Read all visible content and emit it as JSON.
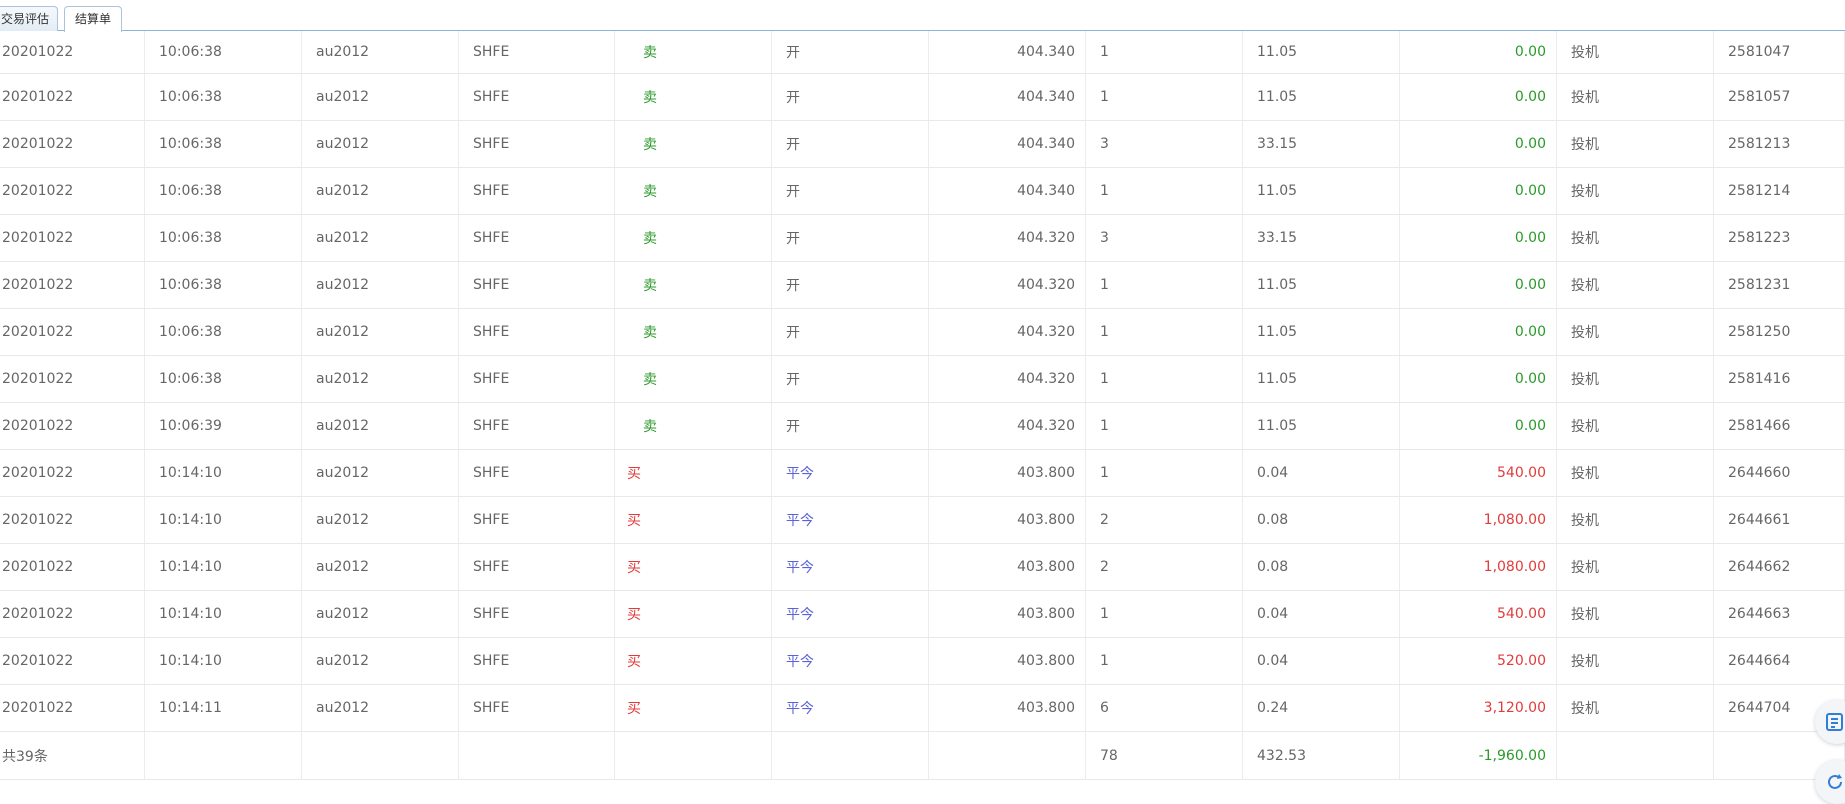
{
  "tabs": [
    {
      "label": "交易评估"
    },
    {
      "label": "结算单"
    }
  ],
  "rows": [
    {
      "date": "20201022",
      "time": "10:06:38",
      "contract": "au2012",
      "exchange": "SHFE",
      "direction": "卖",
      "offset": "开",
      "price": "404.340",
      "volume": "1",
      "fee": "11.05",
      "pnl": "0.00",
      "hedge": "投机",
      "trade_id": "2581047"
    },
    {
      "date": "20201022",
      "time": "10:06:38",
      "contract": "au2012",
      "exchange": "SHFE",
      "direction": "卖",
      "offset": "开",
      "price": "404.340",
      "volume": "1",
      "fee": "11.05",
      "pnl": "0.00",
      "hedge": "投机",
      "trade_id": "2581057"
    },
    {
      "date": "20201022",
      "time": "10:06:38",
      "contract": "au2012",
      "exchange": "SHFE",
      "direction": "卖",
      "offset": "开",
      "price": "404.340",
      "volume": "3",
      "fee": "33.15",
      "pnl": "0.00",
      "hedge": "投机",
      "trade_id": "2581213"
    },
    {
      "date": "20201022",
      "time": "10:06:38",
      "contract": "au2012",
      "exchange": "SHFE",
      "direction": "卖",
      "offset": "开",
      "price": "404.340",
      "volume": "1",
      "fee": "11.05",
      "pnl": "0.00",
      "hedge": "投机",
      "trade_id": "2581214"
    },
    {
      "date": "20201022",
      "time": "10:06:38",
      "contract": "au2012",
      "exchange": "SHFE",
      "direction": "卖",
      "offset": "开",
      "price": "404.320",
      "volume": "3",
      "fee": "33.15",
      "pnl": "0.00",
      "hedge": "投机",
      "trade_id": "2581223"
    },
    {
      "date": "20201022",
      "time": "10:06:38",
      "contract": "au2012",
      "exchange": "SHFE",
      "direction": "卖",
      "offset": "开",
      "price": "404.320",
      "volume": "1",
      "fee": "11.05",
      "pnl": "0.00",
      "hedge": "投机",
      "trade_id": "2581231"
    },
    {
      "date": "20201022",
      "time": "10:06:38",
      "contract": "au2012",
      "exchange": "SHFE",
      "direction": "卖",
      "offset": "开",
      "price": "404.320",
      "volume": "1",
      "fee": "11.05",
      "pnl": "0.00",
      "hedge": "投机",
      "trade_id": "2581250"
    },
    {
      "date": "20201022",
      "time": "10:06:38",
      "contract": "au2012",
      "exchange": "SHFE",
      "direction": "卖",
      "offset": "开",
      "price": "404.320",
      "volume": "1",
      "fee": "11.05",
      "pnl": "0.00",
      "hedge": "投机",
      "trade_id": "2581416"
    },
    {
      "date": "20201022",
      "time": "10:06:39",
      "contract": "au2012",
      "exchange": "SHFE",
      "direction": "卖",
      "offset": "开",
      "price": "404.320",
      "volume": "1",
      "fee": "11.05",
      "pnl": "0.00",
      "hedge": "投机",
      "trade_id": "2581466"
    },
    {
      "date": "20201022",
      "time": "10:14:10",
      "contract": "au2012",
      "exchange": "SHFE",
      "direction": "买",
      "offset": "平今",
      "price": "403.800",
      "volume": "1",
      "fee": "0.04",
      "pnl": "540.00",
      "hedge": "投机",
      "trade_id": "2644660"
    },
    {
      "date": "20201022",
      "time": "10:14:10",
      "contract": "au2012",
      "exchange": "SHFE",
      "direction": "买",
      "offset": "平今",
      "price": "403.800",
      "volume": "2",
      "fee": "0.08",
      "pnl": "1,080.00",
      "hedge": "投机",
      "trade_id": "2644661"
    },
    {
      "date": "20201022",
      "time": "10:14:10",
      "contract": "au2012",
      "exchange": "SHFE",
      "direction": "买",
      "offset": "平今",
      "price": "403.800",
      "volume": "2",
      "fee": "0.08",
      "pnl": "1,080.00",
      "hedge": "投机",
      "trade_id": "2644662"
    },
    {
      "date": "20201022",
      "time": "10:14:10",
      "contract": "au2012",
      "exchange": "SHFE",
      "direction": "买",
      "offset": "平今",
      "price": "403.800",
      "volume": "1",
      "fee": "0.04",
      "pnl": "540.00",
      "hedge": "投机",
      "trade_id": "2644663"
    },
    {
      "date": "20201022",
      "time": "10:14:10",
      "contract": "au2012",
      "exchange": "SHFE",
      "direction": "买",
      "offset": "平今",
      "price": "403.800",
      "volume": "1",
      "fee": "0.04",
      "pnl": "520.00",
      "hedge": "投机",
      "trade_id": "2644664"
    },
    {
      "date": "20201022",
      "time": "10:14:11",
      "contract": "au2012",
      "exchange": "SHFE",
      "direction": "买",
      "offset": "平今",
      "price": "403.800",
      "volume": "6",
      "fee": "0.24",
      "pnl": "3,120.00",
      "hedge": "投机",
      "trade_id": "2644704"
    }
  ],
  "footer": {
    "count_label": "共39条",
    "total_volume": "78",
    "total_fee": "432.53",
    "total_pnl": "-1,960.00"
  },
  "colors": {
    "sell": "#2a9a2a",
    "buy": "#e23b3b",
    "close_today": "#5a63d8",
    "zero_pnl": "#2a9a2a",
    "positive_pnl": "#e23b3b",
    "negative_pnl": "#2a9a2a"
  },
  "icons": {
    "float_1": "document-list-icon",
    "float_2": "refresh-icon"
  }
}
